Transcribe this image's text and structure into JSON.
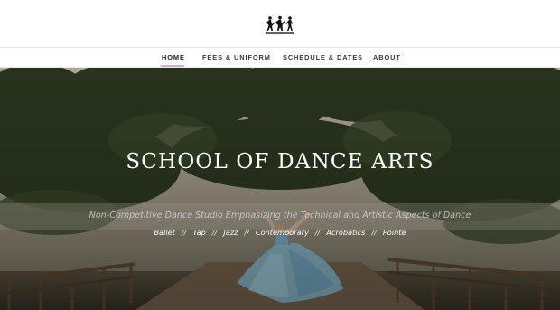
{
  "site": {
    "logo_icon": "dancers-logo-icon"
  },
  "nav": {
    "items": [
      {
        "label": "HOME",
        "active": true
      },
      {
        "label": "FEES & UNIFORM",
        "active": false
      },
      {
        "label": "SCHEDULE & DATES",
        "active": false
      },
      {
        "label": "ABOUT",
        "active": false
      }
    ],
    "active_color": "#d4a8d8"
  },
  "hero": {
    "title": "SCHOOL OF DANCE ARTS",
    "subtitle": "Non-Competitive Dance Studio Emphasizing the Technical and Artistic Aspects of Dance",
    "styles": [
      "Ballet",
      "Tap",
      "Jazz",
      "Contemporary",
      "Acrobatics",
      "Pointe"
    ],
    "separator": "//"
  }
}
